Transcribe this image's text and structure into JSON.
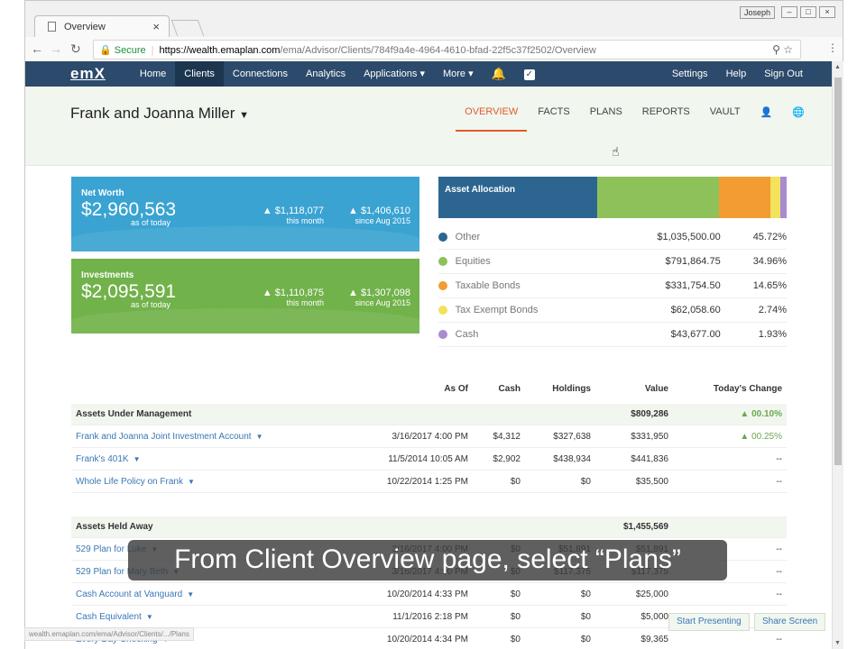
{
  "browser": {
    "tab_title": "Overview",
    "url_secure": "Secure",
    "url_host": "https://wealth.emaplan.com",
    "url_path": "/ema/Advisor/Clients/784f9a4e-4964-4610-bfad-22f5c37f2502/Overview",
    "user": "Joseph"
  },
  "nav": {
    "logo": "emX",
    "items": [
      "Home",
      "Clients",
      "Connections",
      "Analytics",
      "Applications ▾",
      "More ▾"
    ],
    "right": [
      "Settings",
      "Help",
      "Sign Out"
    ]
  },
  "client": {
    "name": "Frank and Joanna Miller"
  },
  "tabs": [
    "OVERVIEW",
    "FACTS",
    "PLANS",
    "REPORTS",
    "VAULT"
  ],
  "net_worth": {
    "label": "Net Worth",
    "value": "$2,960,563",
    "sub": "as of today",
    "c1": "▲ $1,118,077",
    "c1_sub": "this month",
    "c2": "▲ $1,406,610",
    "c2_sub": "since Aug 2015"
  },
  "investments": {
    "label": "Investments",
    "value": "$2,095,591",
    "sub": "as of today",
    "c1": "▲ $1,110,875",
    "c1_sub": "this month",
    "c2": "▲ $1,307,098",
    "c2_sub": "since Aug 2015"
  },
  "allocation": {
    "title": "Asset Allocation",
    "rows": [
      {
        "name": "Other",
        "value": "$1,035,500.00",
        "pct": "45.72%",
        "pct_num": 45.72,
        "color": "#2c6690"
      },
      {
        "name": "Equities",
        "value": "$791,864.75",
        "pct": "34.96%",
        "pct_num": 34.96,
        "color": "#8fc15a"
      },
      {
        "name": "Taxable Bonds",
        "value": "$331,754.50",
        "pct": "14.65%",
        "pct_num": 14.65,
        "color": "#f39c32"
      },
      {
        "name": "Tax Exempt Bonds",
        "value": "$62,058.60",
        "pct": "2.74%",
        "pct_num": 2.74,
        "color": "#f2e25c"
      },
      {
        "name": "Cash",
        "value": "$43,677.00",
        "pct": "1.93%",
        "pct_num": 1.93,
        "color": "#a98bd0"
      }
    ]
  },
  "table_head": [
    "As Of",
    "Cash",
    "Holdings",
    "Value",
    "Today's Change"
  ],
  "groups": [
    {
      "title": "Assets Under Management",
      "value": "$809,286",
      "change": "▲ 00.10%",
      "rows": [
        {
          "name": "Frank and Joanna Joint Investment Account",
          "asof": "3/16/2017 4:00 PM",
          "cash": "$4,312",
          "holdings": "$327,638",
          "value": "$331,950",
          "change": "▲ 00.25%"
        },
        {
          "name": "Frank's 401K",
          "asof": "11/5/2014 10:05 AM",
          "cash": "$2,902",
          "holdings": "$438,934",
          "value": "$441,836",
          "change": "--"
        },
        {
          "name": "Whole Life Policy on Frank",
          "asof": "10/22/2014 1:25 PM",
          "cash": "$0",
          "holdings": "$0",
          "value": "$35,500",
          "change": "--"
        }
      ]
    },
    {
      "title": "Assets Held Away",
      "value": "$1,455,569",
      "change": "",
      "rows": [
        {
          "name": "529 Plan for Luke",
          "asof": "3/16/2017 4:00 PM",
          "cash": "$0",
          "holdings": "$51,891",
          "value": "$51,891",
          "change": "--"
        },
        {
          "name": "529 Plan for Mary Beth",
          "asof": "3/16/2017 4:00 PM",
          "cash": "$0",
          "holdings": "$117,375",
          "value": "$117,375",
          "change": "--"
        },
        {
          "name": "Cash Account at Vanguard",
          "asof": "10/20/2014 4:33 PM",
          "cash": "$0",
          "holdings": "$0",
          "value": "$25,000",
          "change": "--"
        },
        {
          "name": "Cash Equivalent",
          "asof": "11/1/2016 2:18 PM",
          "cash": "$0",
          "holdings": "$0",
          "value": "$5,000",
          "change": "--"
        },
        {
          "name": "Every Day Checking",
          "asof": "10/20/2014 4:34 PM",
          "cash": "$0",
          "holdings": "$0",
          "value": "$9,365",
          "change": "--"
        }
      ]
    }
  ],
  "caption": "From Client Overview page, select “Plans”",
  "status_url": "wealth.emaplan.com/ema/Advisor/Clients/.../Plans",
  "buttons": {
    "present": "Start Presenting",
    "share": "Share Screen"
  }
}
